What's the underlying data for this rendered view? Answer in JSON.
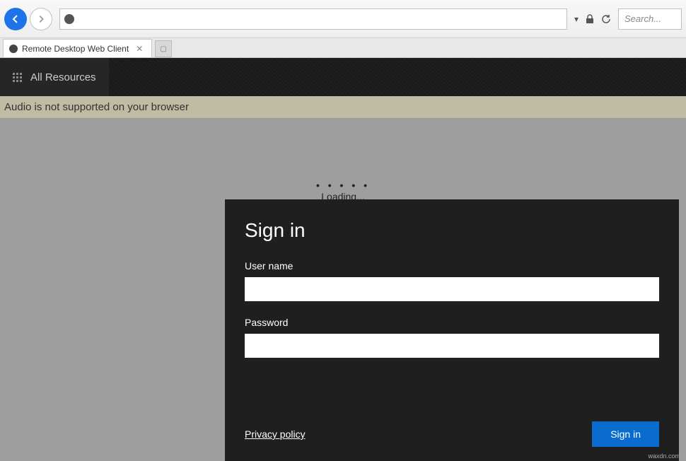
{
  "browser": {
    "tab_title": "Remote Desktop Web Client",
    "search_placeholder": "Search...",
    "addr_dropdown": "▾"
  },
  "app": {
    "header_label": "All Resources",
    "notification": "Audio is not supported on your browser",
    "loading_text": "Loading..."
  },
  "dialog": {
    "title": "Sign in",
    "username_label": "User name",
    "username_value": "",
    "password_label": "Password",
    "password_value": "",
    "privacy_link": "Privacy policy",
    "signin_button": "Sign in"
  },
  "watermark": "waxdn.com"
}
